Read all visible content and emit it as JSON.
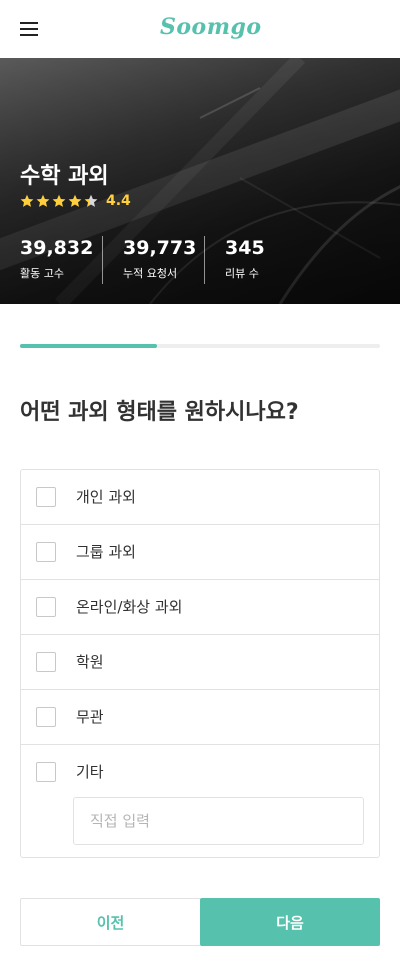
{
  "colors": {
    "accent": "#56c1ac",
    "star": "#ffcf3c",
    "text": "#323232"
  },
  "header": {
    "logo": "Soomgo",
    "menu_icon": "hamburger-menu-icon"
  },
  "hero": {
    "title": "수학 과외",
    "rating": "4.4",
    "rating_value": 4.4,
    "rating_max": 5,
    "stats": [
      {
        "value": "39,832",
        "label": "활동 고수"
      },
      {
        "value": "39,773",
        "label": "누적 요청서"
      },
      {
        "value": "345",
        "label": "리뷰 수"
      }
    ]
  },
  "progress": {
    "fraction": 0.38
  },
  "question": "어떤 과외 형태를 원하시나요?",
  "options": [
    {
      "label": "개인 과외",
      "checked": false
    },
    {
      "label": "그룹 과외",
      "checked": false
    },
    {
      "label": "온라인/화상 과외",
      "checked": false
    },
    {
      "label": "학원",
      "checked": false
    },
    {
      "label": "무관",
      "checked": false
    },
    {
      "label": "기타",
      "checked": false
    }
  ],
  "other_input": {
    "placeholder": "직접 입력",
    "value": ""
  },
  "buttons": {
    "prev": "이전",
    "next": "다음"
  }
}
